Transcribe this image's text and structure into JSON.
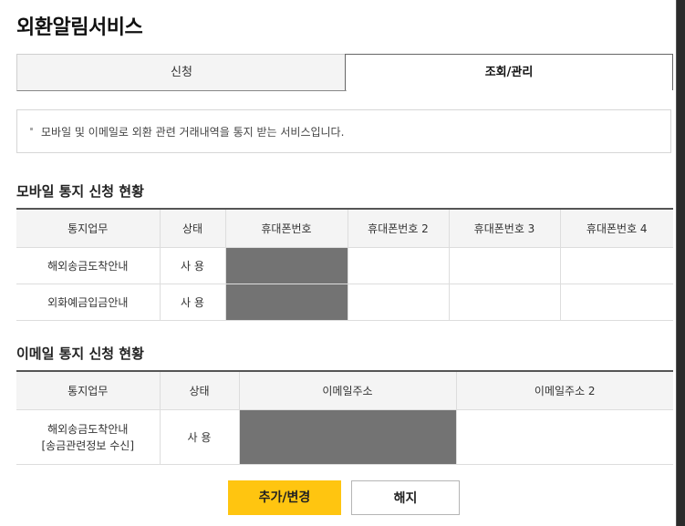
{
  "page": {
    "title": "외환알림서비스"
  },
  "tabs": [
    {
      "label": "신청"
    },
    {
      "label": "조회/관리"
    }
  ],
  "notice": {
    "text": "모바일 및 이메일로 외환 관련 거래내역을 통지 받는 서비스입니다."
  },
  "mobile": {
    "title": "모바일 통지 신청 현황",
    "headers": [
      "통지업무",
      "상태",
      "휴대폰번호",
      "휴대폰번호 2",
      "휴대폰번호 3",
      "휴대폰번호 4"
    ],
    "rows": [
      {
        "task": "해외송금도착안내",
        "status": "사 용"
      },
      {
        "task": "외화예금입금안내",
        "status": "사 용"
      }
    ]
  },
  "email": {
    "title": "이메일 통지 신청 현황",
    "headers": [
      "통지업무",
      "상태",
      "이메일주소",
      "이메일주소 2"
    ],
    "rows": [
      {
        "task_line1": "해외송금도착안내",
        "task_line2": "[송금관련정보 수신]",
        "status": "사 용"
      }
    ]
  },
  "buttons": {
    "primary": "추가/변경",
    "secondary": "해지"
  },
  "colors": {
    "accent": "#ffc510",
    "mask": "#737373",
    "header_bg": "#f4f4f4"
  }
}
